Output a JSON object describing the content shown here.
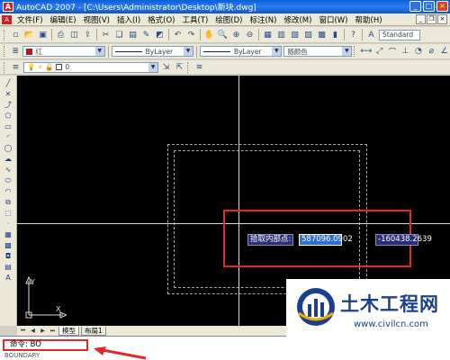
{
  "window": {
    "title": "AutoCAD 2007 - [C:\\Users\\Administrator\\Desktop\\新块.dwg]",
    "minimize": "_",
    "maximize": "□",
    "close": "×"
  },
  "menu": {
    "items": [
      "文件(F)",
      "编辑(E)",
      "视图(V)",
      "插入(I)",
      "格式(O)",
      "工具(T)",
      "绘图(D)",
      "标注(N)",
      "修改(M)",
      "窗口(W)",
      "帮助(H)"
    ]
  },
  "toolbars": {
    "style_combo": "Standard",
    "layer_color": "红",
    "layer_value": "0",
    "linetype": "ByLayer",
    "lineweight": "ByLayer",
    "plotstyle": "随颜色",
    "colors": {
      "layer_swatch": "#ee0000"
    }
  },
  "canvas": {
    "tooltip_label": "拾取内部点:",
    "x_value": "587096.0902",
    "y_value": "-160438.2639",
    "ucs_x": "X",
    "ucs_y": "Y"
  },
  "layout_tabs": {
    "model": "模型",
    "layout1": "布局1"
  },
  "command": {
    "prompt": "命令: BO",
    "history": "BOUNDARY"
  },
  "watermark": {
    "brand": "土木工程网",
    "url": "www.civilcn.com"
  },
  "colors": {
    "canvas_bg": "#000000",
    "highlight_red": "#e02a2a",
    "tooltip_bg": "#2b2e78",
    "input_bg": "#2e6fd6"
  }
}
